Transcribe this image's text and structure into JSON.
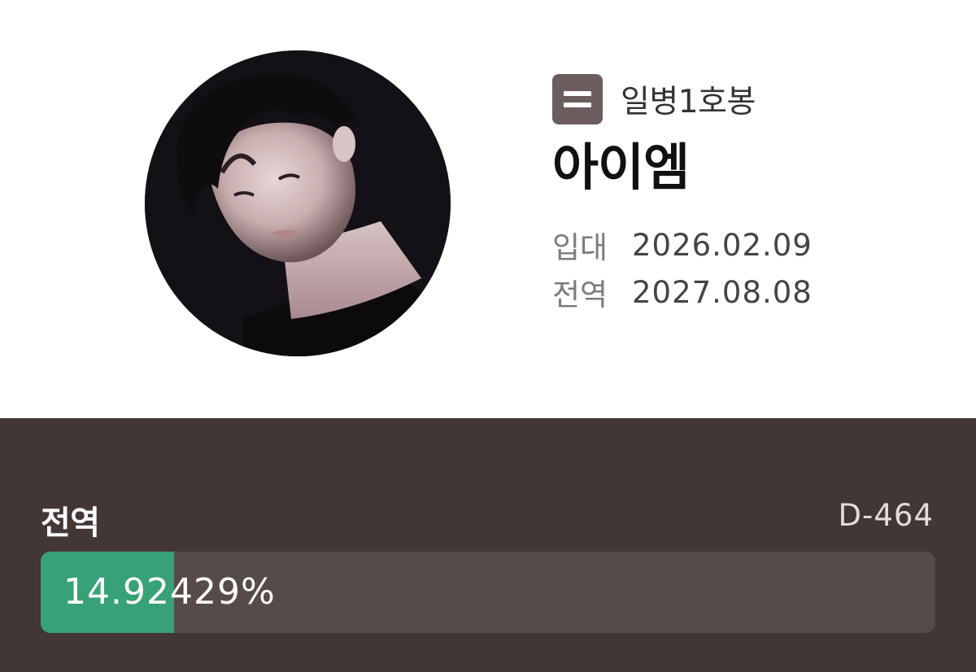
{
  "profile": {
    "rank_icon": "equals-icon",
    "rank": "일병1호봉",
    "name": "아이엠",
    "enlist_label": "입대",
    "enlist_date": "2026.02.09",
    "discharge_label": "전역",
    "discharge_date": "2027.08.08"
  },
  "progress": {
    "title": "전역",
    "dday": "D-464",
    "percent_text": "14.92429%",
    "fraction": 0.1492,
    "fill_color": "#37a177",
    "track_color": "#574b4a",
    "panel_color": "#433736"
  }
}
